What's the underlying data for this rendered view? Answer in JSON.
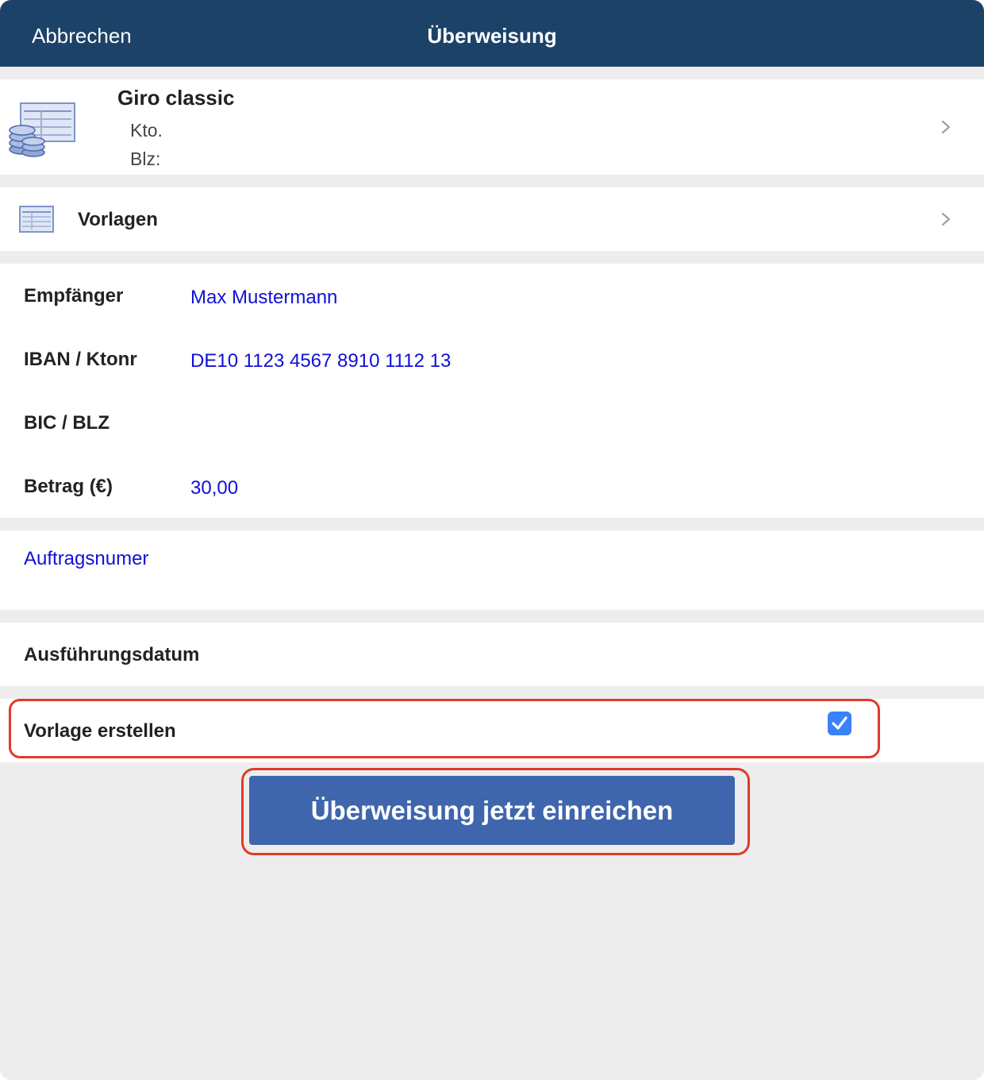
{
  "navbar": {
    "cancel_label": "Abbrechen",
    "title": "Überweisung"
  },
  "account": {
    "name": "Giro classic",
    "kto_label": "Kto.",
    "blz_label": "Blz:"
  },
  "templates": {
    "label": "Vorlagen"
  },
  "fields": {
    "recipient_label": "Empfänger",
    "recipient_value": "Max Mustermann",
    "iban_label": "IBAN / Ktonr",
    "iban_value": "DE10 1123 4567 8910 1112 13",
    "bic_label": "BIC / BLZ",
    "bic_value": "",
    "amount_label": "Betrag (€)",
    "amount_value": "30,00"
  },
  "order": {
    "placeholder": "Auftragsnumer"
  },
  "execution": {
    "label": "Ausführungsdatum"
  },
  "save_template": {
    "label": "Vorlage erstellen",
    "checked": true
  },
  "submit": {
    "label": "Überweisung jetzt einreichen"
  },
  "colors": {
    "navbar": "#1c4268",
    "link_blue": "#1010d6",
    "button": "#3f66ad",
    "highlight": "#e03a2a",
    "checkbox": "#3b82f6"
  }
}
